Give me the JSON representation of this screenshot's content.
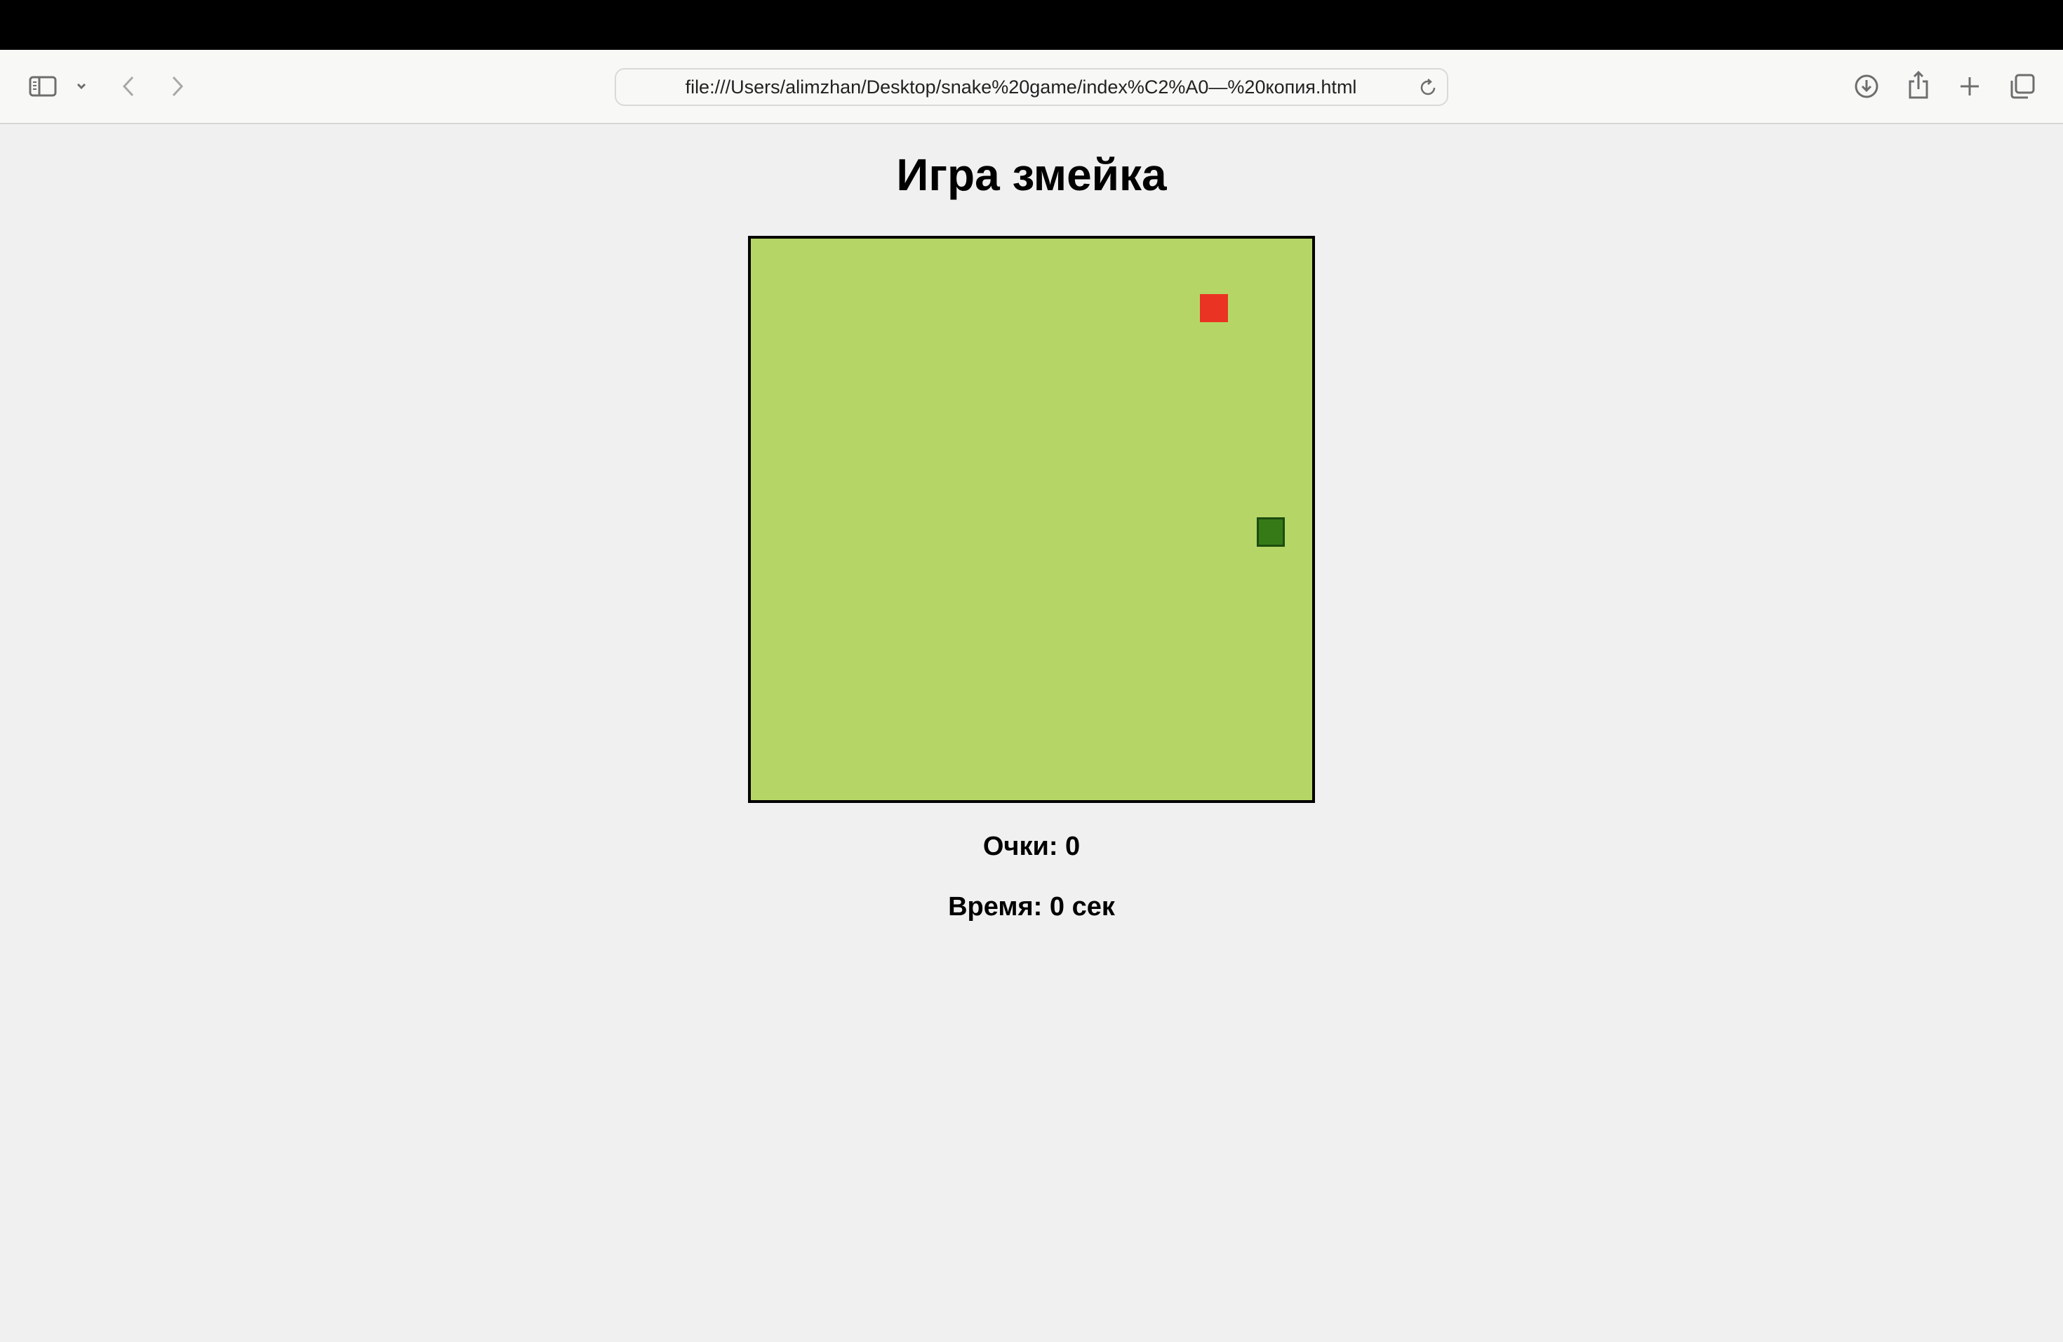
{
  "browser": {
    "url": "file:///Users/alimzhan/Desktop/snake%20game/index%C2%A0—%20копия.html"
  },
  "page": {
    "title": "Игра змейка",
    "score_label": "Очки: 0",
    "time_label": "Время: 0 сек"
  },
  "colors": {
    "board": "#b5d666",
    "food": "#ea3323",
    "snake": "#367a17",
    "page_background": "#f0f0f0"
  },
  "icons": {
    "sidebar": "sidebar-icon",
    "chevron": "chevron-down-icon",
    "back": "back-arrow-icon",
    "forward": "forward-arrow-icon",
    "reload": "reload-icon",
    "downloads": "download-icon",
    "share": "share-icon",
    "new_tab": "plus-icon",
    "tabs": "tab-overview-icon"
  }
}
